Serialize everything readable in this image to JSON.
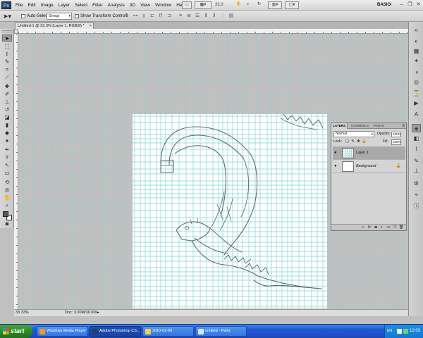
{
  "menubar": {
    "logo": "Ps",
    "items": [
      "File",
      "Edit",
      "Image",
      "Layer",
      "Select",
      "Filter",
      "Analysis",
      "3D",
      "View",
      "Window",
      "Help"
    ],
    "zoom": "33.3",
    "workspace": "BASIC",
    "workspace_arrow": "▾"
  },
  "options": {
    "auto_select_label": "Auto-Select:",
    "auto_select_value": "Group",
    "transform_controls_label": "Show Transform Controls"
  },
  "document": {
    "tab_title": "Untitled-1 @ 33.3% (Layer 1, RGB/8) *",
    "close": "×"
  },
  "status": {
    "zoom": "33.33%",
    "doc": "Doc: 3.00M/30.0M",
    "arrow": "▸"
  },
  "layers_panel": {
    "tabs": [
      "LAYERS",
      "CHANNELS",
      "PATHS"
    ],
    "blend_mode": "Normal",
    "opacity_label": "Opacity:",
    "opacity": "100%",
    "lock_label": "Lock:",
    "fill_label": "Fill:",
    "fill": "100%",
    "layers": [
      {
        "name": "Layer 1",
        "selected": true
      },
      {
        "name": "Background",
        "selected": false
      }
    ]
  },
  "taskbar": {
    "start": "start",
    "tasks": [
      "Windows Media Player",
      "Adobe Photoshop CS...",
      "2010-02-09",
      "untitled - Paint"
    ],
    "lang": "EN",
    "clock": "12:03"
  },
  "colors": {
    "guide": "#7fd3cf",
    "sketch": "#5d6a70",
    "taskbar": "#2257d5",
    "start": "#2b8a26"
  }
}
